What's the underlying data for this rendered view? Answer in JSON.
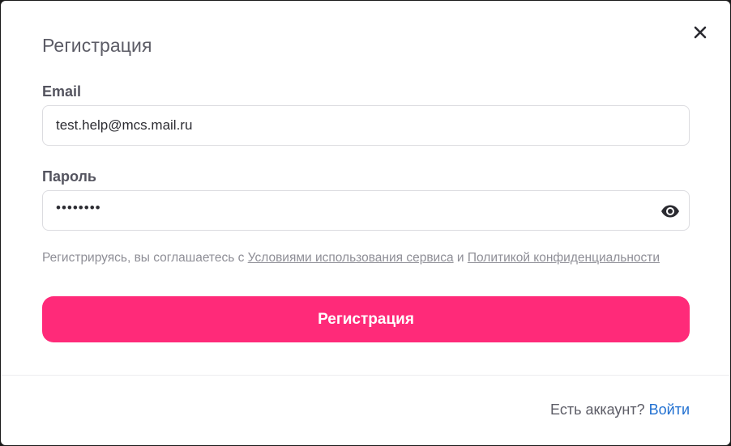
{
  "modal": {
    "title": "Регистрация",
    "close_icon": "close-icon"
  },
  "form": {
    "email_label": "Email",
    "email_value": "test.help@mcs.mail.ru",
    "password_label": "Пароль",
    "password_masked": "••••••••",
    "password_toggle_icon": "eye-icon",
    "terms_prefix": "Регистрируясь, вы соглашаетесь с ",
    "terms_link": "Условиями использования сервиса",
    "terms_and": " и ",
    "privacy_link": "Политикой конфиденциальности",
    "submit_label": "Регистрация"
  },
  "footer": {
    "question": "Есть аккаунт? ",
    "login_link": "Войти"
  },
  "colors": {
    "accent": "#ff2a79",
    "link": "#1f6fd1"
  }
}
